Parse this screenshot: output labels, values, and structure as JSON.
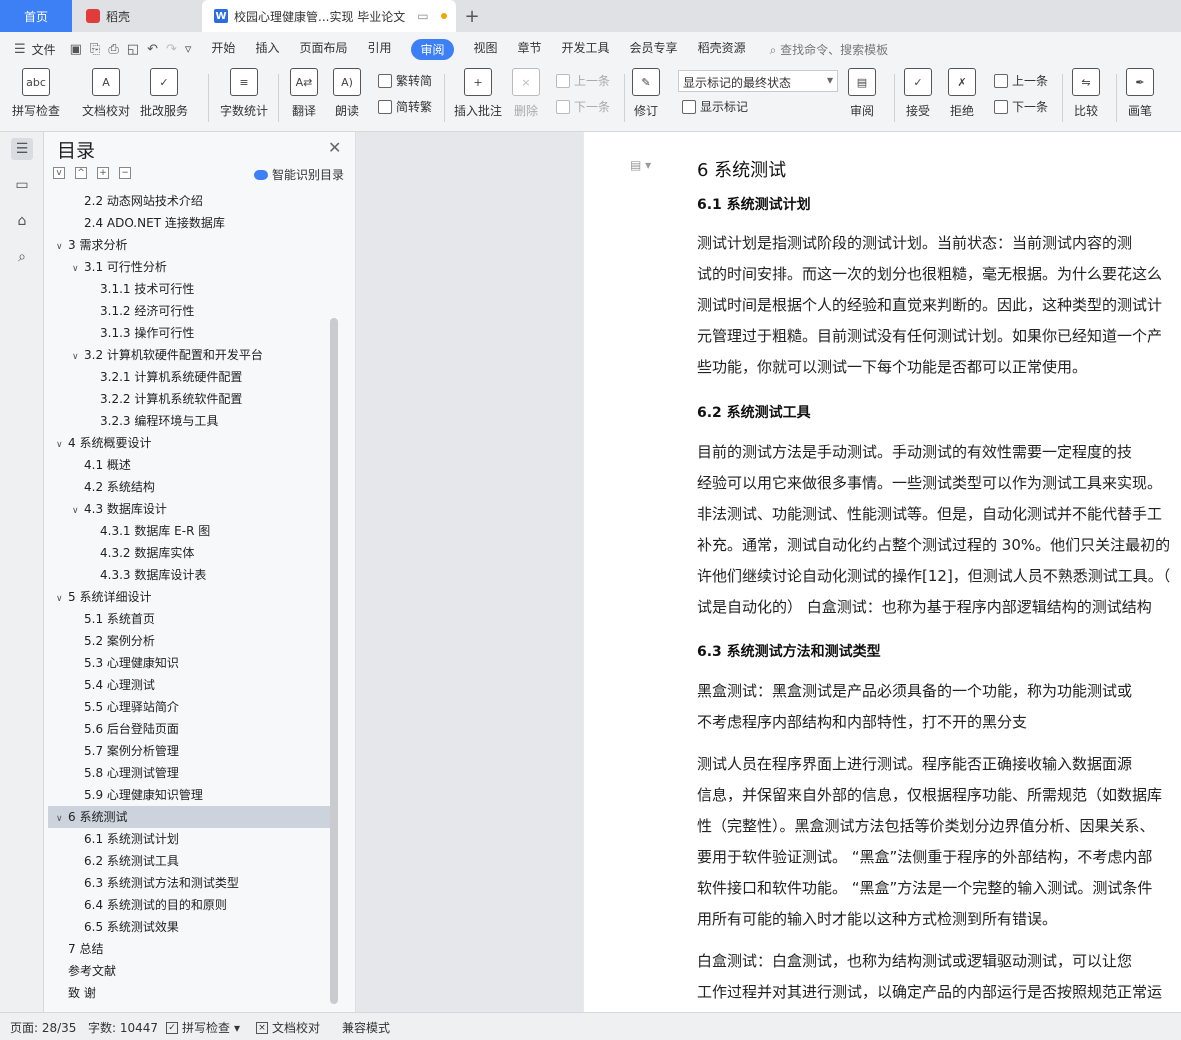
{
  "tabs": {
    "home": "首页",
    "daoke": "稻壳",
    "doc": "校园心理健康管...实现 毕业论文",
    "plus": "+"
  },
  "menu": {
    "file": "文件",
    "items": [
      "开始",
      "插入",
      "页面布局",
      "引用",
      "审阅",
      "视图",
      "章节",
      "开发工具",
      "会员专享",
      "稻壳资源"
    ],
    "active": "审阅",
    "search": "查找命令、搜索模板"
  },
  "toolbar": {
    "spellcheck": "拼写检查",
    "doccheck": "文档校对",
    "batchservice": "批改服务",
    "wordcount": "字数统计",
    "translate": "翻译",
    "read": "朗读",
    "trad": "繁转简",
    "simp": "简转繁",
    "insert_comment": "插入批注",
    "delete": "删除",
    "prev": "上一条",
    "next": "下一条",
    "revise": "修订",
    "mark_state": "显示标记的最终状态",
    "show_marks": "显示标记",
    "review": "审阅",
    "accept": "接受",
    "reject": "拒绝",
    "prev2": "上一条",
    "next2": "下一条",
    "compare": "比较",
    "pen": "画笔"
  },
  "toc": {
    "title": "目录",
    "smart": "智能识别目录",
    "items": [
      {
        "t": "2.2  动态网站技术介绍",
        "lvl": 2,
        "caret": ""
      },
      {
        "t": "2.4 ADO.NET 连接数据库",
        "lvl": 2,
        "caret": ""
      },
      {
        "t": "3  需求分析",
        "lvl": 1,
        "caret": "v"
      },
      {
        "t": "3.1  可行性分析",
        "lvl": 2,
        "caret": "v"
      },
      {
        "t": "3.1.1  技术可行性",
        "lvl": 3,
        "caret": ""
      },
      {
        "t": "3.1.2  经济可行性",
        "lvl": 3,
        "caret": ""
      },
      {
        "t": "3.1.3  操作可行性",
        "lvl": 3,
        "caret": ""
      },
      {
        "t": "3.2  计算机软硬件配置和开发平台",
        "lvl": 2,
        "caret": "v"
      },
      {
        "t": "3.2.1 计算机系统硬件配置",
        "lvl": 3,
        "caret": ""
      },
      {
        "t": "3.2.2 计算机系统软件配置",
        "lvl": 3,
        "caret": ""
      },
      {
        "t": "3.2.3 编程环境与工具",
        "lvl": 3,
        "caret": ""
      },
      {
        "t": "4 系统概要设计",
        "lvl": 1,
        "caret": "v"
      },
      {
        "t": "4.1  概述",
        "lvl": 2,
        "caret": ""
      },
      {
        "t": "4.2  系统结构",
        "lvl": 2,
        "caret": ""
      },
      {
        "t": "4.3  数据库设计",
        "lvl": 2,
        "caret": "v"
      },
      {
        "t": "4.3.1  数据库 E-R 图",
        "lvl": 3,
        "caret": ""
      },
      {
        "t": "4.3.2  数据库实体",
        "lvl": 3,
        "caret": ""
      },
      {
        "t": "4.3.3 数据库设计表",
        "lvl": 3,
        "caret": ""
      },
      {
        "t": "5 系统详细设计",
        "lvl": 1,
        "caret": "v"
      },
      {
        "t": "5.1  系统首页",
        "lvl": 2,
        "caret": ""
      },
      {
        "t": "5.2 案例分析",
        "lvl": 2,
        "caret": ""
      },
      {
        "t": "5.3 心理健康知识",
        "lvl": 2,
        "caret": ""
      },
      {
        "t": "5.4 心理测试",
        "lvl": 2,
        "caret": ""
      },
      {
        "t": "5.5 心理驿站简介",
        "lvl": 2,
        "caret": ""
      },
      {
        "t": "5.6 后台登陆页面",
        "lvl": 2,
        "caret": ""
      },
      {
        "t": "5.7 案例分析管理",
        "lvl": 2,
        "caret": ""
      },
      {
        "t": "5.8 心理测试管理",
        "lvl": 2,
        "caret": ""
      },
      {
        "t": "5.9 心理健康知识管理",
        "lvl": 2,
        "caret": ""
      },
      {
        "t": "6 系统测试",
        "lvl": 1,
        "caret": "v",
        "selected": true
      },
      {
        "t": "6.1 系统测试计划",
        "lvl": 2,
        "caret": ""
      },
      {
        "t": "6.2  系统测试工具",
        "lvl": 2,
        "caret": ""
      },
      {
        "t": "6.3 系统测试方法和测试类型",
        "lvl": 2,
        "caret": ""
      },
      {
        "t": "6.4 系统测试的目的和原则",
        "lvl": 2,
        "caret": ""
      },
      {
        "t": "6.5 系统测试效果",
        "lvl": 2,
        "caret": ""
      },
      {
        "t": "7  总结",
        "lvl": 1,
        "caret": ""
      },
      {
        "t": "参考文献",
        "lvl": 1,
        "caret": ""
      },
      {
        "t": "致    谢",
        "lvl": 1,
        "caret": ""
      }
    ]
  },
  "doc": {
    "h_6": "6 系统测试",
    "h_61": "6.1 系统测试计划",
    "h_62": "6.2  系统测试工具",
    "h_63": "6.3 系统测试方法和测试类型",
    "lines": [
      "        测试计划是指测试阶段的测试计划。当前状态：当前测试内容的测",
      "试的时间安排。而这一次的划分也很粗糙，毫无根据。为什么要花这么",
      "测试时间是根据个人的经验和直觉来判断的。因此，这种类型的测试计",
      "元管理过于粗糙。目前测试没有任何测试计划。如果你已经知道一个产",
      "些功能，你就可以测试一下每个功能是否都可以正常使用。",
      "        目前的测试方法是手动测试。手动测试的有效性需要一定程度的技",
      "经验可以用它来做很多事情。一些测试类型可以作为测试工具来实现。",
      "非法测试、功能测试、性能测试等。但是，自动化测试并不能代替手工",
      "补充。通常，测试自动化约占整个测试过程的 30%。他们只关注最初的",
      "许他们继续讨论自动化测试的操作[12]，但测试人员不熟悉测试工具。（",
      "试是自动化的）  白盒测试：也称为基于程序内部逻辑结构的测试结构",
      "        黑盒测试：黑盒测试是产品必须具备的一个功能，称为功能测试或",
      "不考虑程序内部结构和内部特性，打不开的黑分支",
      "        测试人员在程序界面上进行测试。程序能否正确接收输入数据面源",
      "信息，并保留来自外部的信息，仅根据程序功能、所需规范（如数据库",
      "性（完整性）。黑盒测试方法包括等价类划分边界值分析、因果关系、",
      "要用于软件验证测试。 “黑盒”法侧重于程序的外部结构，不考虑内部",
      "软件接口和软件功能。 “黑盒”方法是一个完整的输入测试。测试条件",
      "用所有可能的输入时才能以这种方式检测到所有错误。",
      "        白盒测试：白盒测试，也称为结构测试或逻辑驱动测试，可以让您",
      "工作过程并对其进行测试，以确定产品的内部运行是否按照规范正常运"
    ]
  },
  "status": {
    "page": "页面: 28/35",
    "words": "字数: 10447",
    "spell": "拼写检查",
    "proof": "文档校对",
    "compat": "兼容模式"
  }
}
